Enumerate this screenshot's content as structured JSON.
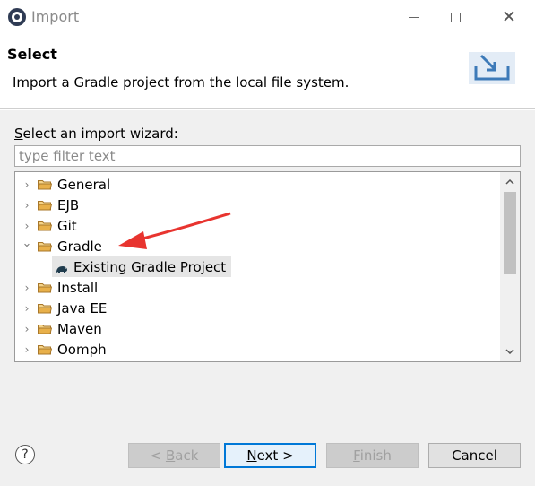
{
  "window": {
    "title": "Import",
    "controls": {
      "minimize_icon": "minimize-icon",
      "maximize_icon": "maximize-icon",
      "close_glyph": "✕"
    }
  },
  "header": {
    "title": "Select",
    "description": "Import a Gradle project from the local file system.",
    "icon": "import-wizard-icon"
  },
  "wizard": {
    "label_underlined": "S",
    "label_rest": "elect an import wizard:",
    "filter_placeholder": "type filter text",
    "filter_value": ""
  },
  "tree": {
    "items": [
      {
        "label": "General",
        "expanded": false
      },
      {
        "label": "EJB",
        "expanded": false
      },
      {
        "label": "Git",
        "expanded": false
      },
      {
        "label": "Gradle",
        "expanded": true
      },
      {
        "label": "Existing Gradle Project",
        "child": true,
        "selected": true
      },
      {
        "label": "Install",
        "expanded": false
      },
      {
        "label": "Java EE",
        "expanded": false
      },
      {
        "label": "Maven",
        "expanded": false
      },
      {
        "label": "Oomph",
        "expanded": false
      }
    ],
    "chevron_collapsed": "›",
    "chevron_expanded": "⌄"
  },
  "annotation": {
    "arrow_color": "#e8342f"
  },
  "footer": {
    "help": "?",
    "back_label": "< Back",
    "back_mnemonic": "B",
    "next_label": "Next >",
    "next_mnemonic": "N",
    "finish_label": "Finish",
    "finish_mnemonic": "F",
    "cancel_label": "Cancel"
  },
  "colors": {
    "folder": "#e8b04a",
    "default_button_border": "#0078d7",
    "disabled_text": "#a0a0a0"
  }
}
